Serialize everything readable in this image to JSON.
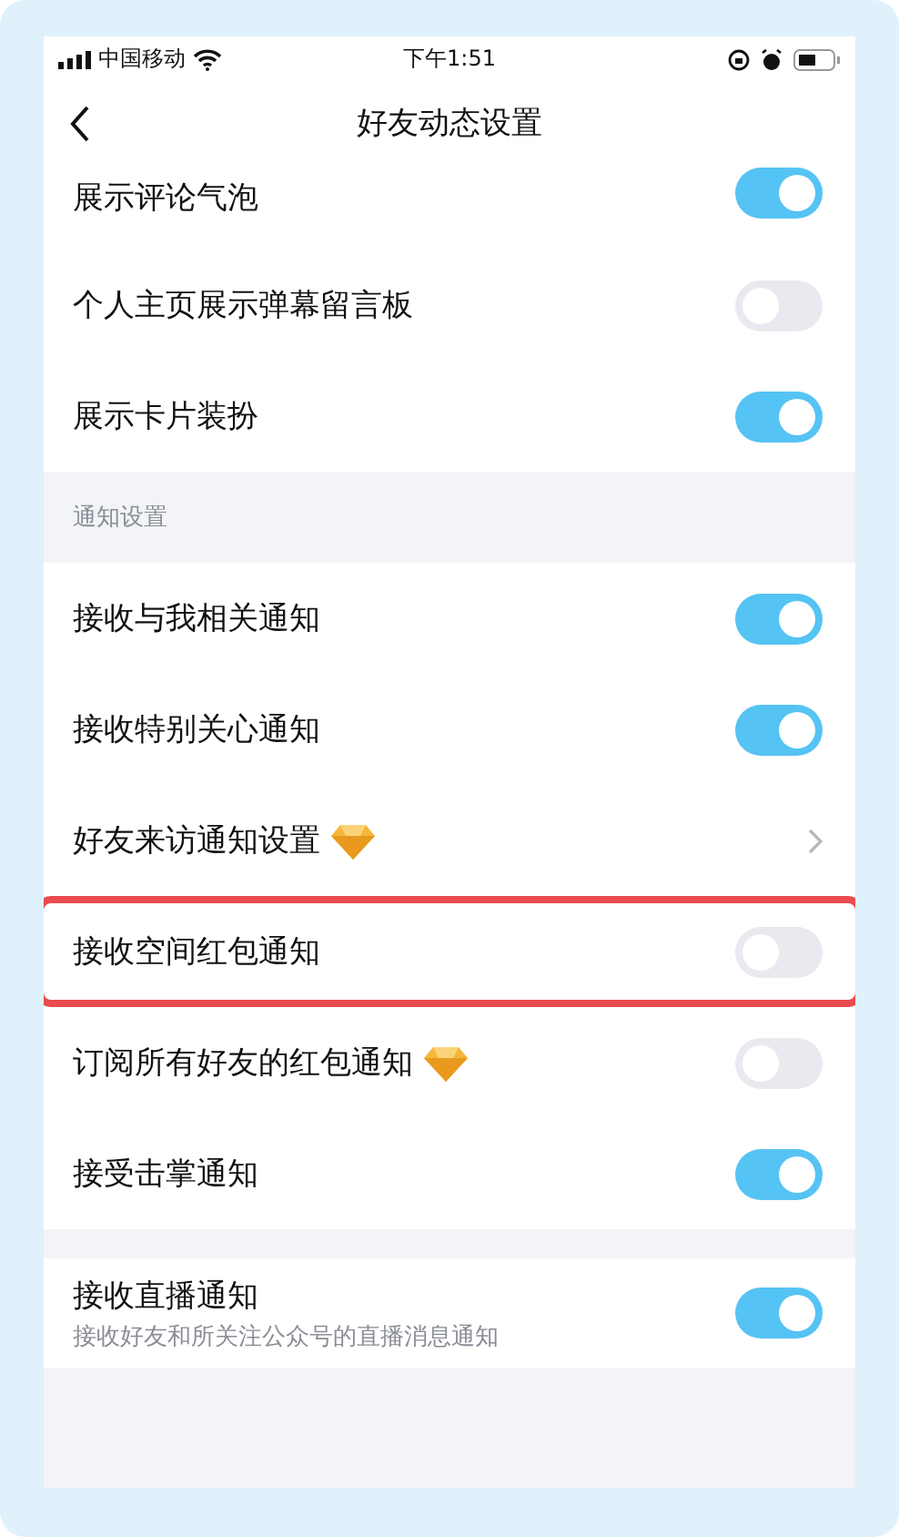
{
  "status_bar": {
    "carrier": "中国移动",
    "time": "下午1:51"
  },
  "nav": {
    "title": "好友动态设置"
  },
  "sections": [
    {
      "rows": [
        {
          "kind": "toggle",
          "label": "展示评论气泡",
          "vip": false,
          "on": true,
          "highlighted": false
        },
        {
          "kind": "toggle",
          "label": "个人主页展示弹幕留言板",
          "vip": false,
          "on": false,
          "highlighted": false
        },
        {
          "kind": "toggle",
          "label": "展示卡片装扮",
          "vip": false,
          "on": true,
          "highlighted": false
        }
      ]
    },
    {
      "header": "通知设置",
      "rows": [
        {
          "kind": "toggle",
          "label": "接收与我相关通知",
          "vip": false,
          "on": true,
          "highlighted": false
        },
        {
          "kind": "toggle",
          "label": "接收特别关心通知",
          "vip": false,
          "on": true,
          "highlighted": false
        },
        {
          "kind": "link",
          "label": "好友来访通知设置",
          "vip": true,
          "highlighted": false
        },
        {
          "kind": "toggle",
          "label": "接收空间红包通知",
          "vip": false,
          "on": false,
          "highlighted": true
        },
        {
          "kind": "toggle",
          "label": "订阅所有好友的红包通知",
          "vip": true,
          "on": false,
          "highlighted": false
        },
        {
          "kind": "toggle",
          "label": "接受击掌通知",
          "vip": false,
          "on": true,
          "highlighted": false
        }
      ]
    },
    {
      "rows": [
        {
          "kind": "toggle",
          "label": "接收直播通知",
          "sublabel": "接收好友和所关注公众号的直播消息通知",
          "vip": false,
          "on": true,
          "highlighted": false
        }
      ]
    }
  ]
}
